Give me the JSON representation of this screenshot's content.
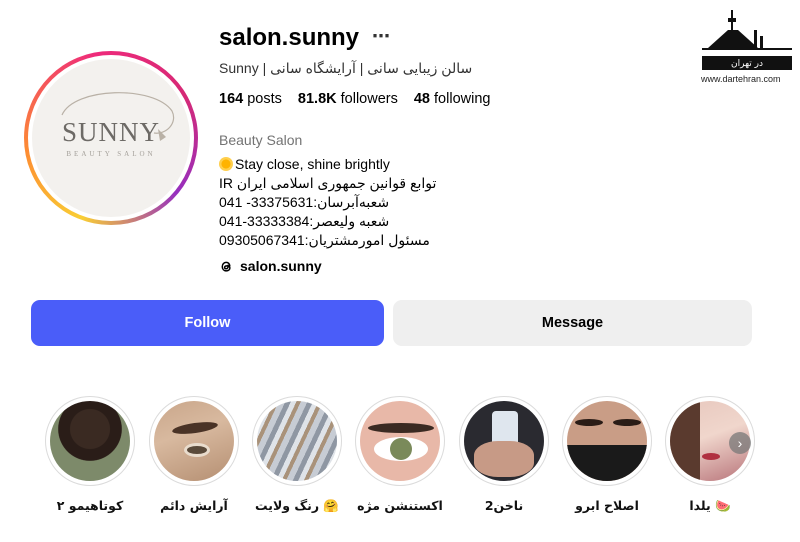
{
  "profile": {
    "username": "salon.sunny",
    "more_icon": "⋯",
    "full_name": "Sunny | سالن زیبایی سانی | آرایشگاه سانی",
    "stats": {
      "posts_count": "164",
      "posts_label": "posts",
      "followers_count": "81.8K",
      "followers_label": "followers",
      "following_count": "48",
      "following_label": "following"
    },
    "category": "Beauty Salon",
    "bio": {
      "line1": "Stay close, shine brightly",
      "line2": "IR توابع قوانین جمهوری اسلامی ایران",
      "line3": "شعبه‌آبرسان:33375631- 041",
      "line4": "شعبه ولیعصر:33333384-041",
      "line5": "مسئول امورمشتریان:09305067341"
    },
    "threads_handle": "salon.sunny",
    "avatar_logo_word": "SUNNY",
    "avatar_logo_sub": "BEAUTY SALON"
  },
  "actions": {
    "follow_label": "Follow",
    "message_label": "Message"
  },
  "highlights": [
    {
      "label": "کوتاهیمو ۲",
      "icon": "haircut-photo"
    },
    {
      "label": "آرایش دائم",
      "icon": "eyebrow-photo"
    },
    {
      "label": "رنگ ولایت 🤗",
      "icon": "hair-color-photo"
    },
    {
      "label": "اکستنشن مژه",
      "icon": "eyelash-photo"
    },
    {
      "label": "ناخن2",
      "icon": "nails-photo"
    },
    {
      "label": "اصلاح ابرو",
      "icon": "brow-shaping-photo"
    },
    {
      "label": "یلدا 🍉",
      "icon": "yalda-photo"
    }
  ],
  "watermark": {
    "brand": "در تهران",
    "url": "www.dartehran.com"
  },
  "colors": {
    "follow_button": "#4a5df9",
    "message_button": "#efefef",
    "secondary_text": "#737373"
  }
}
